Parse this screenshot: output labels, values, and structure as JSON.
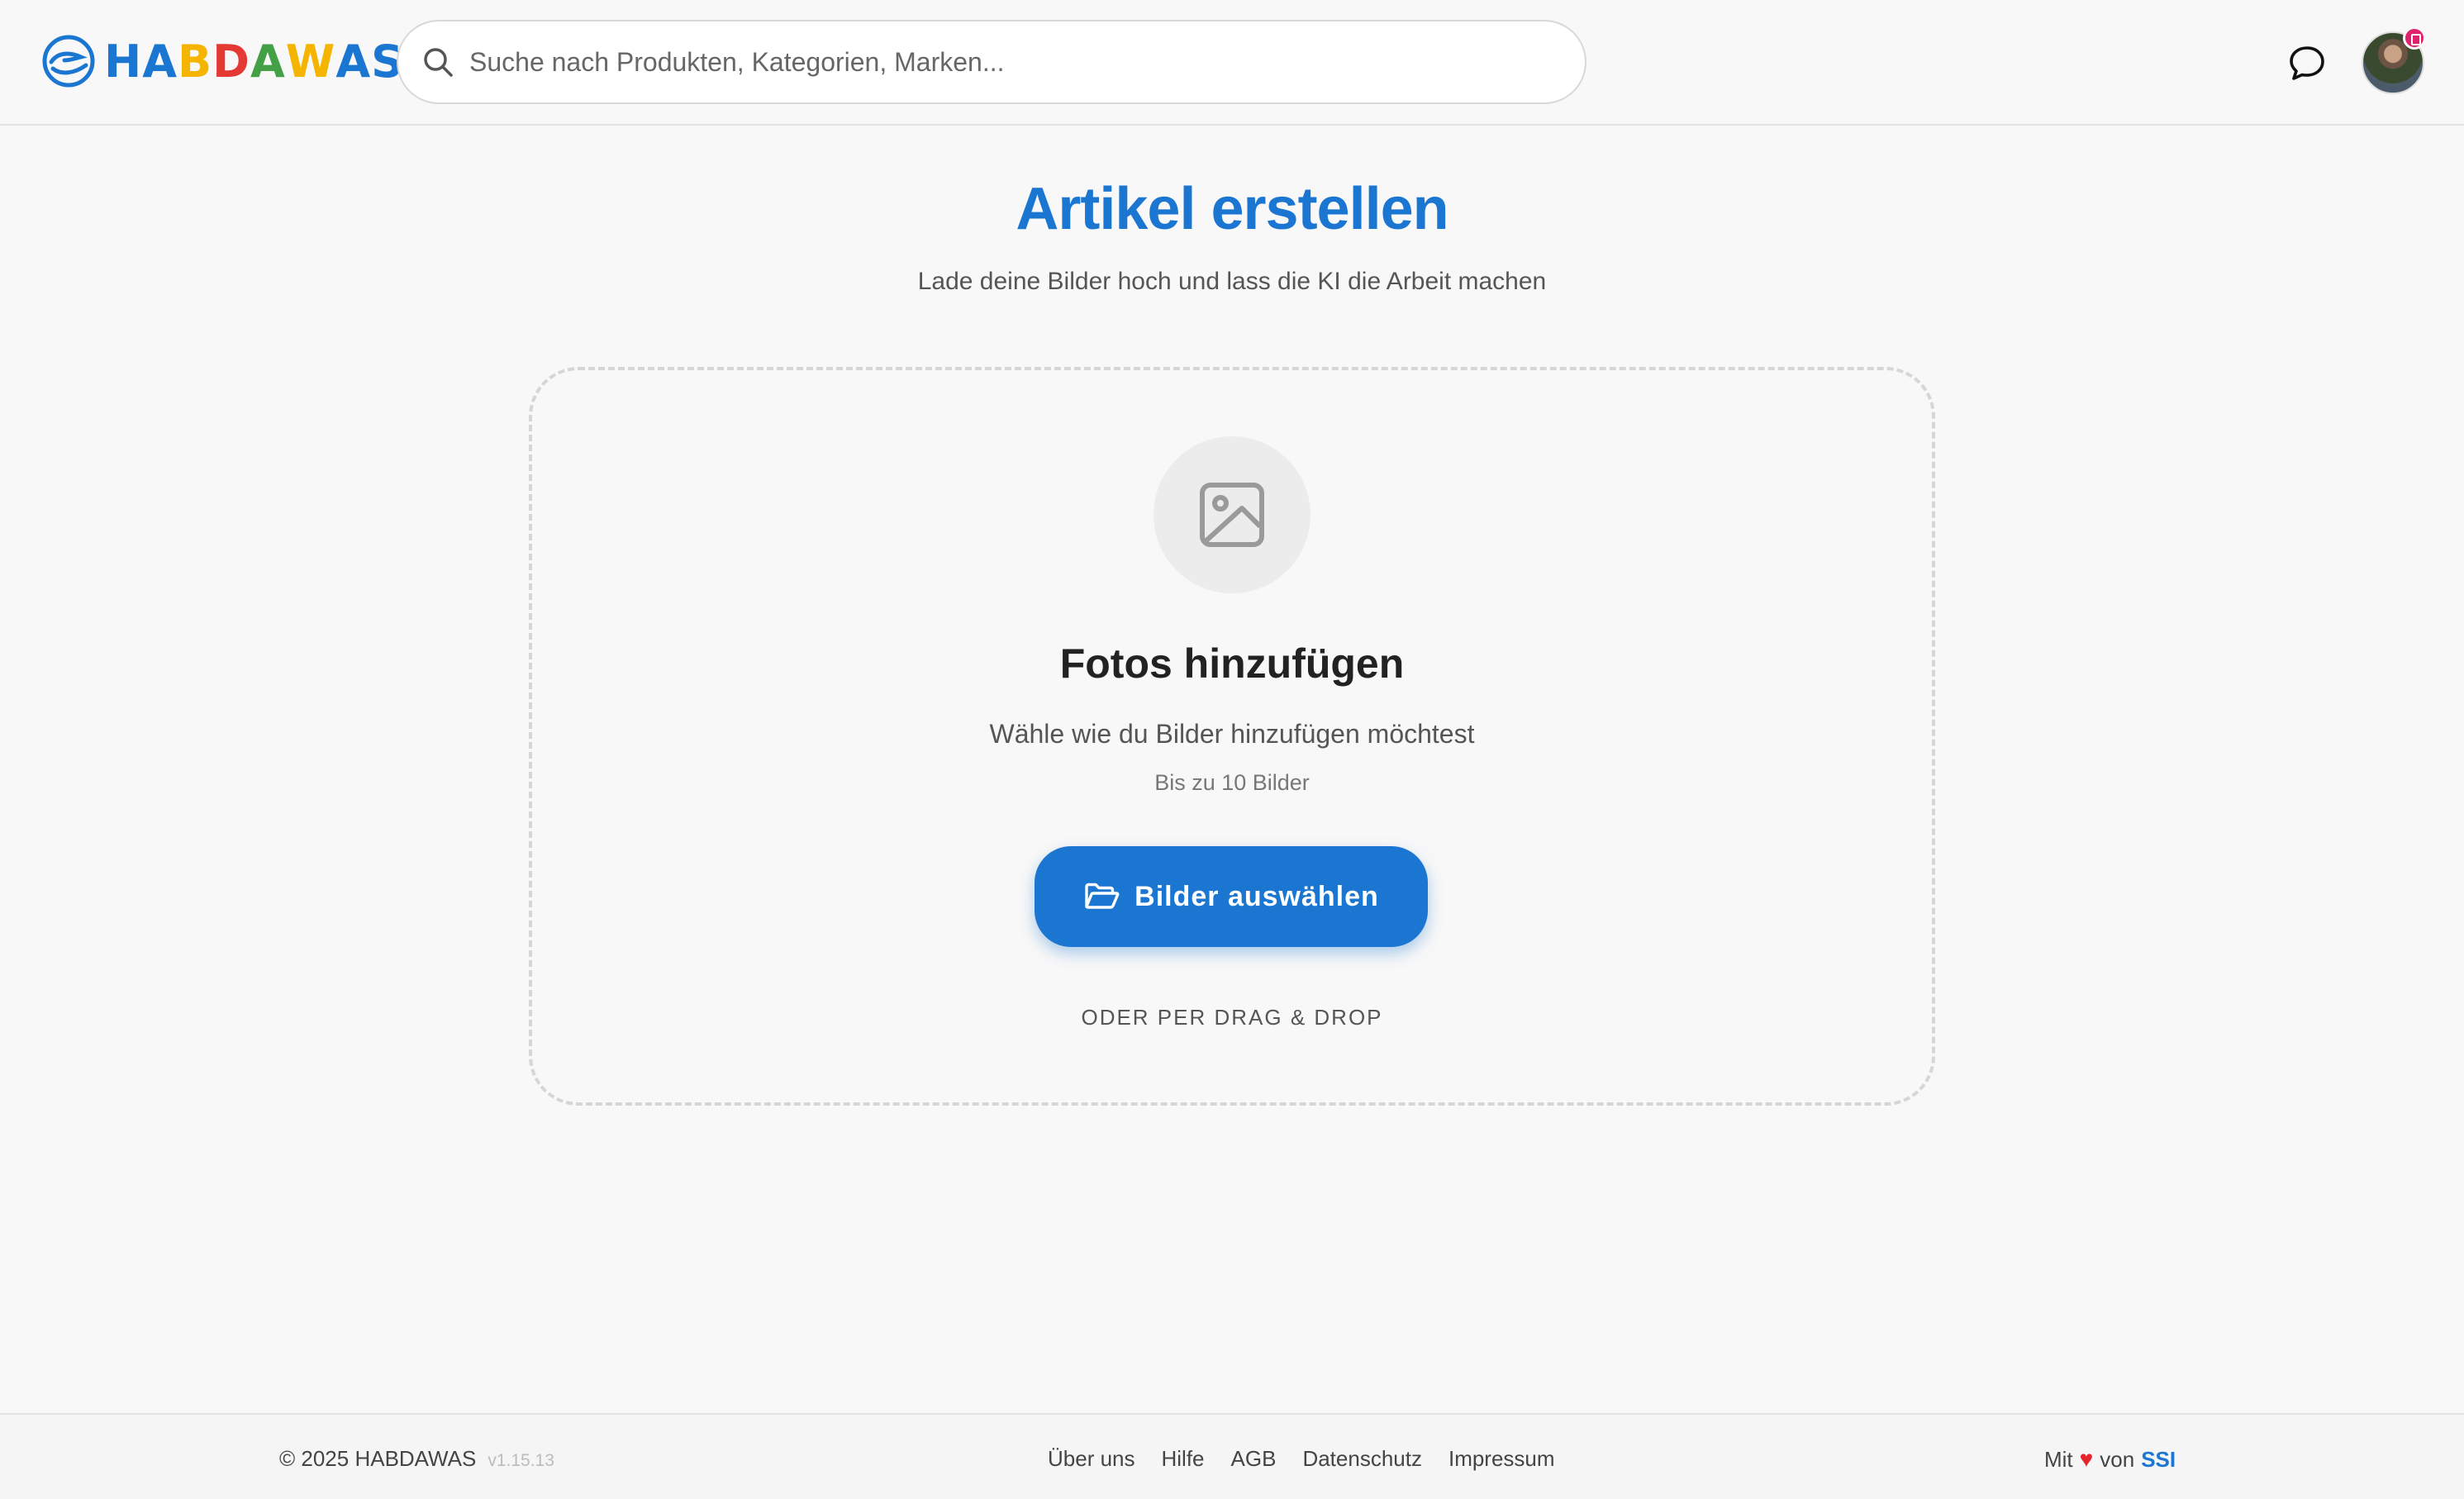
{
  "brand": {
    "logo_letters": [
      {
        "ch": "H",
        "color": "#1b76d2"
      },
      {
        "ch": "A",
        "color": "#1b76d2"
      },
      {
        "ch": "B",
        "color": "#f4b400"
      },
      {
        "ch": "D",
        "color": "#e53935"
      },
      {
        "ch": "A",
        "color": "#43a047"
      },
      {
        "ch": "W",
        "color": "#f4b400"
      },
      {
        "ch": "A",
        "color": "#1b76d2"
      },
      {
        "ch": "S",
        "color": "#1b76d2"
      }
    ],
    "logo_text": "HABDAWAS"
  },
  "header": {
    "search_placeholder": "Suche nach Produkten, Kategorien, Marken...",
    "search_value": ""
  },
  "main": {
    "title": "Artikel erstellen",
    "subtitle": "Lade deine Bilder hoch und lass die KI die Arbeit machen",
    "dropzone": {
      "title": "Fotos hinzufügen",
      "subtitle": "Wähle wie du Bilder hinzufügen möchtest",
      "limit": "Bis zu 10 Bilder",
      "button_label": "Bilder auswählen",
      "drag_drop": "ODER PER DRAG & DROP"
    }
  },
  "footer": {
    "copyright": "© 2025 HABDAWAS",
    "version": "v1.15.13",
    "links": [
      "Über uns",
      "Hilfe",
      "AGB",
      "Datenschutz",
      "Impressum"
    ],
    "made_with_prefix": "Mit",
    "made_with_suffix": "von",
    "made_by": "SSI"
  },
  "colors": {
    "accent": "#1b76d2",
    "heart": "#e5252a",
    "badge": "#e0226e"
  }
}
